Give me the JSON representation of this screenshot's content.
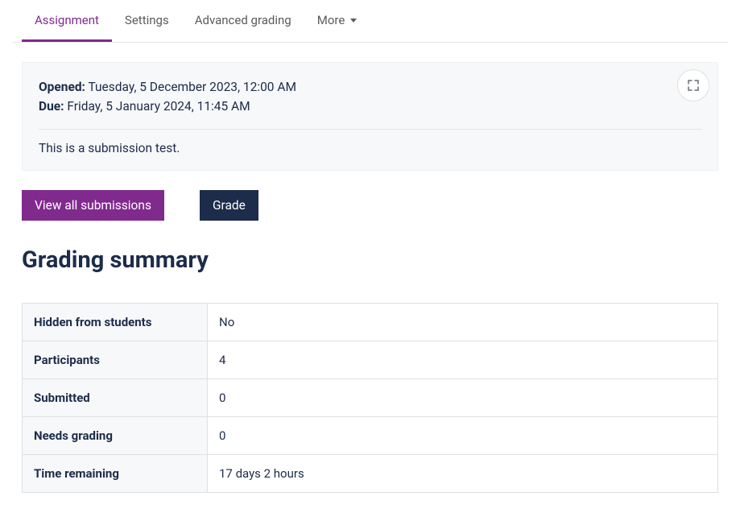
{
  "tabs": {
    "assignment": "Assignment",
    "settings": "Settings",
    "advanced_grading": "Advanced grading",
    "more": "More"
  },
  "info": {
    "opened_label": "Opened:",
    "opened_value": "Tuesday, 5 December 2023, 12:00 AM",
    "due_label": "Due:",
    "due_value": "Friday, 5 January 2024, 11:45 AM",
    "description": "This is a submission test."
  },
  "actions": {
    "view_all": "View all submissions",
    "grade": "Grade"
  },
  "heading": "Grading summary",
  "summary": [
    {
      "label": "Hidden from students",
      "value": "No"
    },
    {
      "label": "Participants",
      "value": "4"
    },
    {
      "label": "Submitted",
      "value": "0"
    },
    {
      "label": "Needs grading",
      "value": "0"
    },
    {
      "label": "Time remaining",
      "value": "17 days 2 hours"
    }
  ]
}
